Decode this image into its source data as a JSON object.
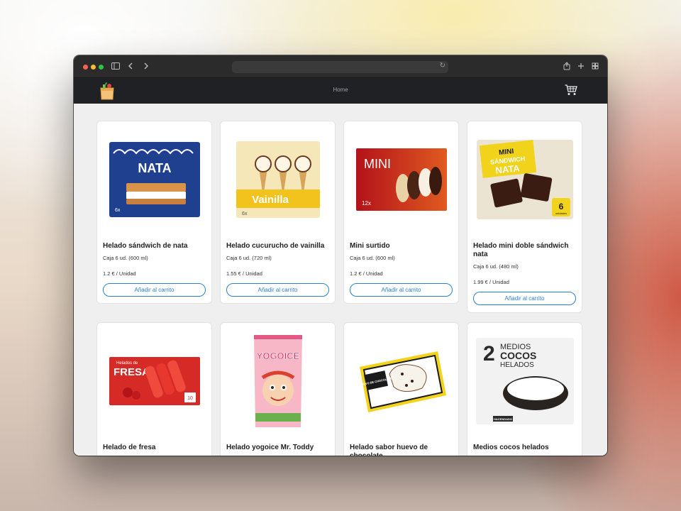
{
  "nav": {
    "home_label": "Home"
  },
  "products": [
    {
      "name": "Helado sándwich de nata",
      "pack": "Caja 6 ud. (600 ml)",
      "price": "1.2 € / Unidad",
      "button": "Añadir al carrito",
      "image": "nata-sandwich-box",
      "img_text": "NATA",
      "img_text2": "6x"
    },
    {
      "name": "Helado cucurucho de vainilla",
      "pack": "Caja 6 ud. (720 ml)",
      "price": "1.55 € / Unidad",
      "button": "Añadir al carrito",
      "image": "vanilla-cone-box",
      "img_text": "Vainilla",
      "img_text2": "6x"
    },
    {
      "name": "Mini surtido",
      "pack": "Caja 6 ud. (600 ml)",
      "price": "1.2 € / Unidad",
      "button": "Añadir al carrito",
      "image": "mini-assortment-box",
      "img_text": "MINI",
      "img_text2": "12x"
    },
    {
      "name": "Helado mini doble sándwich nata",
      "pack": "Caja 6 ud. (480 ml)",
      "price": "1.99 € / Unidad",
      "button": "Añadir al carrito",
      "image": "mini-sandwich-box",
      "img_text": "MINI",
      "img_text2": "SÁNDWICH",
      "img_text3": "NATA",
      "img_text4": "6",
      "img_text5": "unidades"
    },
    {
      "name": "Helado de fresa",
      "image": "strawberry-popsicle-box",
      "img_text": "Helados de",
      "img_text2": "FRESA",
      "img_text3": "10"
    },
    {
      "name": "Helado yogoice Mr. Toddy",
      "image": "yogoice-wrapper",
      "img_text": "YOGOICE"
    },
    {
      "name": "Helado sabor huevo de chocolate",
      "image": "chocolate-egg-tub",
      "img_text": "HUEVO DE CHOCOLATE"
    },
    {
      "name": "Medios cocos helados",
      "image": "coconut-halves-box",
      "img_text": "2",
      "img_text2": "MEDIOS",
      "img_text3": "COCOS",
      "img_text4": "HELADOS",
      "img_text5": "HACENDADO"
    }
  ],
  "colors": {
    "accent": "#2a7fd3",
    "navbar": "#202124",
    "titlebar": "#2b2b2b"
  }
}
